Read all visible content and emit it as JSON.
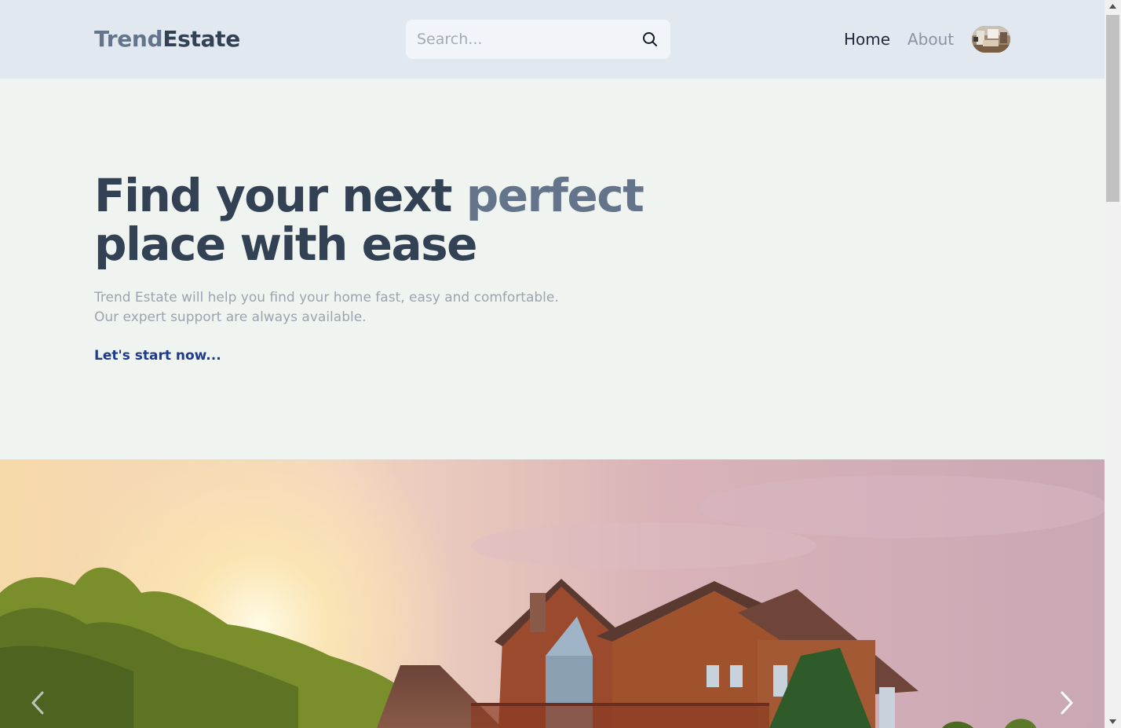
{
  "header": {
    "logo_part1": "Trend",
    "logo_part2": "Estate",
    "search_placeholder": "Search...",
    "nav": {
      "home": "Home",
      "about": "About"
    }
  },
  "hero": {
    "title_part1": "Find your next ",
    "title_accent": "perfect",
    "title_part2": "place with ease",
    "subtitle_line1": "Trend Estate will help you find your home fast, easy and comfortable.",
    "subtitle_line2": "Our expert support are always available.",
    "cta": "Let's start now..."
  },
  "carousel": {
    "slide_image": "house-at-sunset",
    "prev_icon": "chevron-left-icon",
    "next_icon": "chevron-right-icon"
  },
  "colors": {
    "header_bg": "#e2e8f0",
    "page_bg": "#f0f4f1",
    "title_dark": "#334155",
    "title_accent": "#64748b",
    "cta": "#1e3a8a"
  }
}
